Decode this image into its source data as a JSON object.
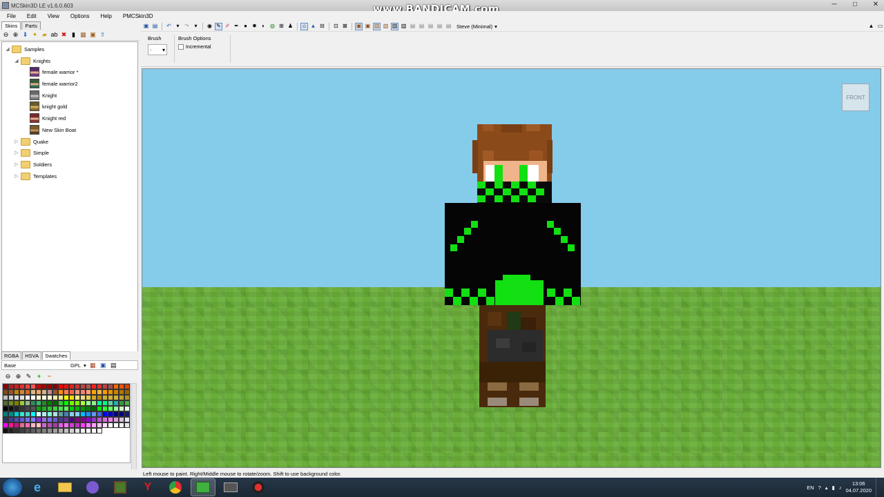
{
  "window": {
    "title": "MCSkin3D LE v1.6.0.603",
    "controls": [
      "─",
      "□",
      "✕"
    ]
  },
  "watermark": "www.BANDICAM.com",
  "menu": [
    "File",
    "Edit",
    "View",
    "Options",
    "Help",
    "PMCSkin3D"
  ],
  "left_tabs": [
    "Skins",
    "Parts"
  ],
  "tree": {
    "samples": "Samples",
    "knights": "Knights",
    "skins": [
      "female warrior *",
      "female warrior2",
      "Knight",
      "knight gold",
      "Knight red",
      "New Skin Boat"
    ],
    "folders": [
      "Quake",
      "Simple",
      "Soldiers",
      "Templates"
    ]
  },
  "color_tabs": [
    "RGBA",
    "HSVA",
    "Swatches"
  ],
  "palette": {
    "name": "Base",
    "format": "GPL"
  },
  "model_select": "Steve (Minimal)",
  "options": {
    "brush_label": "Brush",
    "brush_value": "·",
    "brush_options_label": "Brush Options",
    "incremental_label": "Incremental"
  },
  "viewport": {
    "front_label": "FRONT"
  },
  "status": "Left mouse to paint. Right/Middle mouse to rotate/zoom. Shift to use background color.",
  "taskbar": {
    "language": "EN",
    "time": "13:06",
    "date": "04.07.2020"
  },
  "swatch_colors": [
    "#8b0000",
    "#b22222",
    "#cc2222",
    "#dd3333",
    "#ee4444",
    "#ff5555",
    "#cc0000",
    "#aa0000",
    "#990000",
    "#880000",
    "#ff0000",
    "#ee1111",
    "#dd2222",
    "#cc3333",
    "#bb4444",
    "#aa5555",
    "#ff2020",
    "#e03030",
    "#c04040",
    "#a05050",
    "#ff6600",
    "#ee5500",
    "#dd4400",
    "#8b4513",
    "#a0522d",
    "#b8860b",
    "#cd853f",
    "#d2691e",
    "#deb887",
    "#f4a460",
    "#d2b48c",
    "#bc8f8f",
    "#a0522d",
    "#ff8c00",
    "#ff7f50",
    "#ff6347",
    "#e9967a",
    "#fa8072",
    "#ffa07a",
    "#ffa500",
    "#ffb347",
    "#ff9900",
    "#e69500",
    "#cc8400",
    "#b37400",
    "#996300",
    "#c0c0c0",
    "#d3d3d3",
    "#dcdcdc",
    "#e0e0e0",
    "#f5f5f5",
    "#ffffff",
    "#fffacd",
    "#ffffe0",
    "#fafad2",
    "#eee8aa",
    "#f0e68c",
    "#ffff00",
    "#ffd700",
    "#ffec8b",
    "#eedd82",
    "#e3cf57",
    "#daa520",
    "#b8860b",
    "#c9b037",
    "#d4af37",
    "#cfb53b",
    "#bfa030",
    "#a89030",
    "#556b2f",
    "#6b8e23",
    "#808000",
    "#9acd32",
    "#8fbc8f",
    "#2e8b57",
    "#3cb371",
    "#228b22",
    "#008000",
    "#006400",
    "#32cd32",
    "#00ff00",
    "#7cfc00",
    "#7fff00",
    "#adff2f",
    "#98fb98",
    "#90ee90",
    "#00fa9a",
    "#00ff7f",
    "#66cdaa",
    "#20b2aa",
    "#3a9a3a",
    "#4ab04a",
    "#000000",
    "#111111",
    "#222222",
    "#333333",
    "#444444",
    "#555555",
    "#10a010",
    "#20b020",
    "#30c030",
    "#40d040",
    "#50e050",
    "#60f060",
    "#00cc00",
    "#00b300",
    "#009900",
    "#008000",
    "#006600",
    "#00e600",
    "#33ff33",
    "#66ff66",
    "#99ff99",
    "#ccffcc",
    "#e6ffe6",
    "#008080",
    "#008b8b",
    "#00ced1",
    "#40e0d0",
    "#48d1cc",
    "#00ffff",
    "#e0ffff",
    "#afeeee",
    "#7fffd4",
    "#b0e0e6",
    "#5f9ea0",
    "#4682b4",
    "#87ceeb",
    "#87cefa",
    "#00bfff",
    "#1e90ff",
    "#6495ed",
    "#4169e1",
    "#0000ff",
    "#0000cd",
    "#00008b",
    "#000080",
    "#191970",
    "#2f2f5f",
    "#3f3f8f",
    "#4f4faf",
    "#5f5fcf",
    "#6f6fef",
    "#7f7fff",
    "#8a2be2",
    "#9370db",
    "#7b68ee",
    "#6a5acd",
    "#483d8b",
    "#663399",
    "#4b0082",
    "#800080",
    "#8b008b",
    "#9400d3",
    "#9932cc",
    "#ba55d3",
    "#da70d6",
    "#ee82ee",
    "#dda0dd",
    "#d8bfd8",
    "#e6e6fa",
    "#ff00ff",
    "#ff1493",
    "#c71585",
    "#db7093",
    "#ff69b4",
    "#ffb6c1",
    "#ffc0cb",
    "#cc66cc",
    "#b050b0",
    "#a040a0",
    "#e060e0",
    "#f070f0",
    "#d040d0",
    "#c030c0",
    "#ff40ff",
    "#ff80ff",
    "#ffa0ff",
    "#ffc0ff",
    "#ffe0ff",
    "#ffffff",
    "#f8f8f8",
    "#f0f0f0",
    "#e8e8e8",
    "#101010",
    "#202020",
    "#303030",
    "#404040",
    "#505050",
    "#606060",
    "#707070",
    "#808080",
    "#909090",
    "#a0a0a0",
    "#b0b0b0",
    "#c0c0c0",
    "#d0d0d0",
    "#e0e0e0",
    "#f0f0f0",
    "#ffffff",
    "#ffffff",
    "#ffffff"
  ]
}
